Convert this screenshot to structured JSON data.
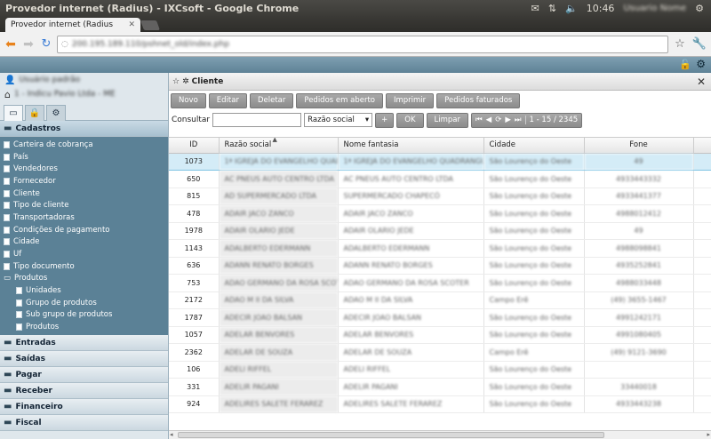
{
  "os": {
    "window_title": "Provedor internet (Radius) - IXCsoft - Google Chrome",
    "clock": "10:46",
    "user": "Usuario Nome"
  },
  "browser": {
    "tab_title": "Provedor internet (Radius",
    "url": "200.195.189.110/pshnet_old/index.php"
  },
  "sidebar": {
    "user": "Usuário padrão",
    "company": "1 - Indicu Pavio Ltda - ME",
    "sections": {
      "cadastros": "Cadastros",
      "entradas": "Entradas",
      "saidas": "Saídas",
      "pagar": "Pagar",
      "receber": "Receber",
      "financeiro": "Financeiro",
      "fiscal": "Fiscal"
    },
    "items": [
      "Carteira de cobrança",
      "País",
      "Vendedores",
      "Fornecedor",
      "Cliente",
      "Tipo de cliente",
      "Transportadoras",
      "Condições de pagamento",
      "Cidade",
      "Uf",
      "Tipo documento",
      "Produtos"
    ],
    "subitems": [
      "Unidades",
      "Grupo de produtos",
      "Sub grupo de produtos",
      "Produtos"
    ]
  },
  "panel": {
    "title": "Cliente",
    "buttons": {
      "novo": "Novo",
      "editar": "Editar",
      "deletar": "Deletar",
      "pedidos_aberto": "Pedidos em aberto",
      "imprimir": "Imprimir",
      "pedidos_faturados": "Pedidos faturados"
    },
    "filter": {
      "label": "Consultar",
      "value": "",
      "field": "Razão social",
      "plus": "+",
      "ok": "OK",
      "limpar": "Limpar"
    },
    "pager": {
      "info": "1 - 15 / 2345"
    },
    "columns": {
      "id": "ID",
      "razao": "Razão social",
      "fantasia": "Nome fantasia",
      "cidade": "Cidade",
      "fone": "Fone"
    },
    "rows": [
      {
        "id": "1073",
        "razao": "1ª IGREJA DO EVANGELHO QUADRANGULAR",
        "fantasia": "1ª IGREJA DO EVANGELHO QUADRANGULAR",
        "cidade": "São Lourenço do Oeste",
        "fone": "49"
      },
      {
        "id": "650",
        "razao": "AC PNEUS AUTO CENTRO LTDA",
        "fantasia": "AC PNEUS AUTO CENTRO LTDA",
        "cidade": "São Lourenço do Oeste",
        "fone": "4933443332"
      },
      {
        "id": "815",
        "razao": "AD SUPERMERCADO LTDA",
        "fantasia": "SUPERMERCADO CHAPECÓ",
        "cidade": "São Lourenço do Oeste",
        "fone": "4933441377"
      },
      {
        "id": "478",
        "razao": "ADAIR JACO ZANCO",
        "fantasia": "ADAIR JACO ZANCO",
        "cidade": "São Lourenço do Oeste",
        "fone": "4988012412"
      },
      {
        "id": "1978",
        "razao": "ADAIR OLARIO JEDE",
        "fantasia": "ADAIR OLARIO JEDE",
        "cidade": "São Lourenço do Oeste",
        "fone": "49"
      },
      {
        "id": "1143",
        "razao": "ADALBERTO EDERMANN",
        "fantasia": "ADALBERTO EDERMANN",
        "cidade": "São Lourenço do Oeste",
        "fone": "4988098841"
      },
      {
        "id": "636",
        "razao": "ADANN RENATO BORGES",
        "fantasia": "ADANN RENATO BORGES",
        "cidade": "São Lourenço do Oeste",
        "fone": "4935252841"
      },
      {
        "id": "753",
        "razao": "ADAO GERMANO DA ROSA SCOTER",
        "fantasia": "ADAO GERMANO DA ROSA SCOTER",
        "cidade": "São Lourenço do Oeste",
        "fone": "4988033448"
      },
      {
        "id": "2172",
        "razao": "ADAO M II DA SILVA",
        "fantasia": "ADAO M II DA SILVA",
        "cidade": "Campo Erê",
        "fone": "(49) 3655-1467"
      },
      {
        "id": "1787",
        "razao": "ADECIR JOAO BALSAN",
        "fantasia": "ADECIR JOAO BALSAN",
        "cidade": "São Lourenço do Oeste",
        "fone": "4991242171"
      },
      {
        "id": "1057",
        "razao": "ADELAR BENVORES",
        "fantasia": "ADELAR BENVORES",
        "cidade": "São Lourenço do Oeste",
        "fone": "4991080405"
      },
      {
        "id": "2362",
        "razao": "ADELAR DE SOUZA",
        "fantasia": "ADELAR DE SOUZA",
        "cidade": "Campo Erê",
        "fone": "(49) 9121-3690"
      },
      {
        "id": "106",
        "razao": "ADELI RIFFEL",
        "fantasia": "ADELI RIFFEL",
        "cidade": "São Lourenço do Oeste",
        "fone": ""
      },
      {
        "id": "331",
        "razao": "ADELIR PAGANI",
        "fantasia": "ADELIR PAGANI",
        "cidade": "São Lourenço do Oeste",
        "fone": "33440018"
      },
      {
        "id": "924",
        "razao": "ADELIRES SALETE FERAREZ",
        "fantasia": "ADELIRES SALETE FERAREZ",
        "cidade": "São Lourenço do Oeste",
        "fone": "4933443238"
      }
    ]
  }
}
